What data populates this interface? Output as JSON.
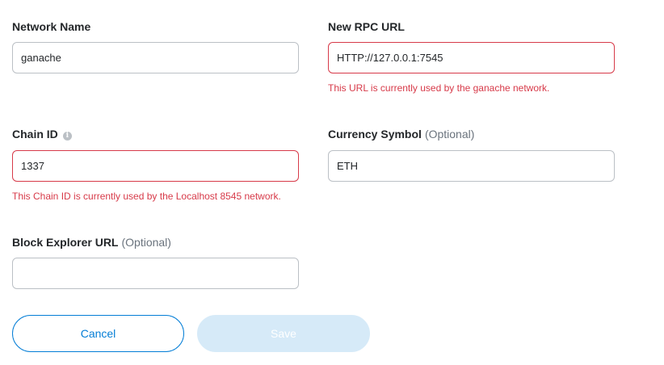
{
  "form": {
    "network_name": {
      "label": "Network Name",
      "value": "ganache"
    },
    "rpc_url": {
      "label": "New RPC URL",
      "value": "HTTP://127.0.0.1:7545",
      "error": "This URL is currently used by the ganache network."
    },
    "chain_id": {
      "label": "Chain ID",
      "info_icon": "info-icon",
      "value": "1337",
      "error": "This Chain ID is currently used by the Localhost 8545 network."
    },
    "currency_symbol": {
      "label": "Currency Symbol",
      "optional": "(Optional)",
      "value": "ETH"
    },
    "block_explorer": {
      "label": "Block Explorer URL",
      "optional": "(Optional)",
      "value": ""
    }
  },
  "actions": {
    "cancel_label": "Cancel",
    "save_label": "Save",
    "save_disabled": true
  },
  "colors": {
    "primary": "#037dd6",
    "error": "#d73a49",
    "border": "#bbc0c5",
    "disabled_button": "#d6eaf8"
  }
}
